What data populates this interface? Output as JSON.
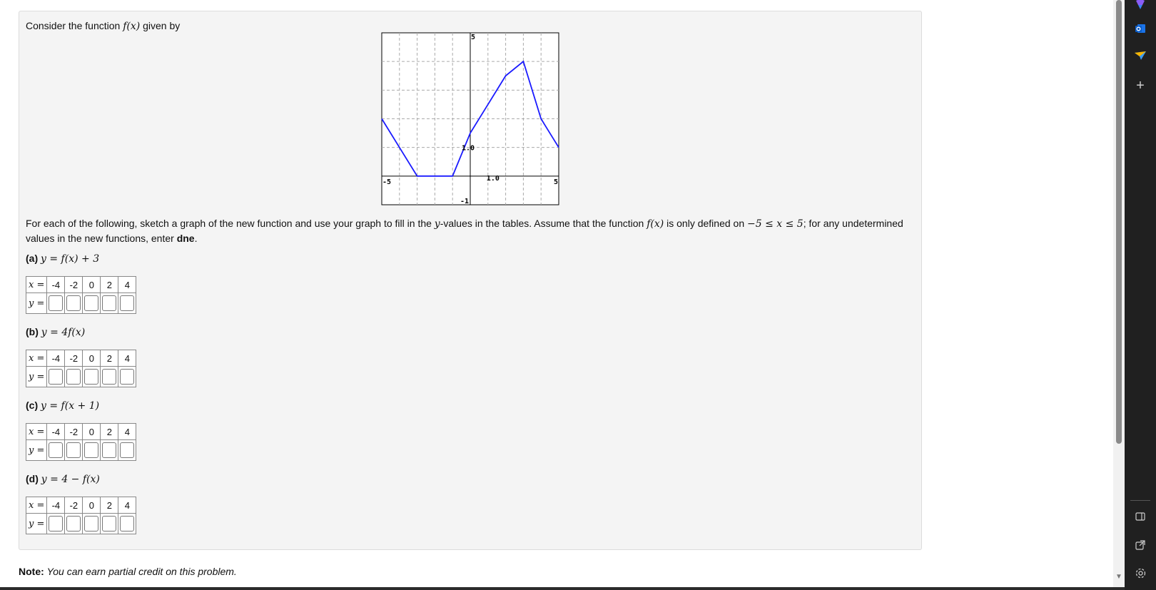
{
  "problem": {
    "intro_prefix": "Consider the function",
    "intro_func": "f(x)",
    "intro_suffix": "given by",
    "instructions_1": "For each of the following, sketch a graph of the new function and use your graph to fill in the",
    "instructions_y": "y",
    "instructions_2": "-values in the tables. Assume that the function",
    "instructions_func": "f(x)",
    "instructions_3": "is only defined on",
    "instructions_domain": "−5 ≤ x ≤ 5",
    "instructions_4": "; for any undetermined values in the new functions, enter",
    "instructions_dne": "dne",
    "instructions_end": "."
  },
  "graph": {
    "tick_labels": {
      "xmin": "-5",
      "xmax": "5",
      "ymax": "5",
      "ymin": "-1",
      "x_unit": "1.0",
      "y_unit": "1.0"
    },
    "line_color": "#1a1aff"
  },
  "chart_data": {
    "type": "line",
    "x": [
      -5,
      -4,
      -3,
      -2,
      -1,
      0,
      1,
      2,
      3,
      4,
      5
    ],
    "y": [
      2,
      1,
      0,
      0,
      0,
      1.5,
      2.5,
      3.5,
      4,
      2,
      1
    ],
    "xlim": [
      -5,
      5
    ],
    "ylim": [
      -1,
      5
    ],
    "grid": true
  },
  "parts": [
    {
      "label": "(a)",
      "formula": "y = f(x) + 3"
    },
    {
      "label": "(b)",
      "formula": "y = 4f(x)"
    },
    {
      "label": "(c)",
      "formula": "y = f(x + 1)"
    },
    {
      "label": "(d)",
      "formula": "y = 4 − f(x)"
    }
  ],
  "table": {
    "x_header": "x =",
    "y_header": "y =",
    "x_values": [
      "-4",
      "-2",
      "0",
      "2",
      "4"
    ]
  },
  "note": {
    "bold": "Note:",
    "text": "You can earn partial credit on this problem."
  }
}
